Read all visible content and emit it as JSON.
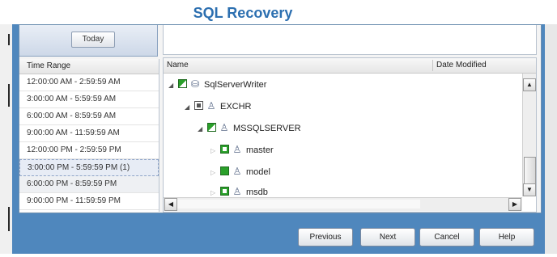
{
  "window": {
    "title": "SQL Recovery"
  },
  "top": {
    "today_label": "Today"
  },
  "time_range": {
    "header": "Time Range",
    "rows": [
      "12:00:00 AM - 2:59:59 AM",
      "3:00:00 AM - 5:59:59 AM",
      "6:00:00 AM - 8:59:59 AM",
      "9:00:00 AM - 11:59:59 AM",
      "12:00:00 PM - 2:59:59 PM",
      "3:00:00 PM - 5:59:59 PM (1)",
      "6:00:00 PM - 8:59:59 PM",
      "9:00:00 PM - 11:59:59 PM"
    ],
    "selected_index": 5
  },
  "tree": {
    "columns": {
      "name": "Name",
      "date": "Date Modified"
    },
    "nodes": [
      {
        "label": "SqlServerWriter",
        "icon": "writer-icon"
      },
      {
        "label": "EXCHR",
        "icon": "server-icon"
      },
      {
        "label": "MSSQLSERVER",
        "icon": "instance-icon"
      },
      {
        "label": "master",
        "icon": "database-icon"
      },
      {
        "label": "model",
        "icon": "database-icon"
      },
      {
        "label": "msdb",
        "icon": "database-icon"
      }
    ]
  },
  "footer": {
    "previous": "Previous",
    "next": "Next",
    "cancel": "Cancel",
    "help": "Help"
  },
  "colors": {
    "accent": "#2c6fb0",
    "frame": "#4f87bd",
    "check": "#2aa02a"
  }
}
